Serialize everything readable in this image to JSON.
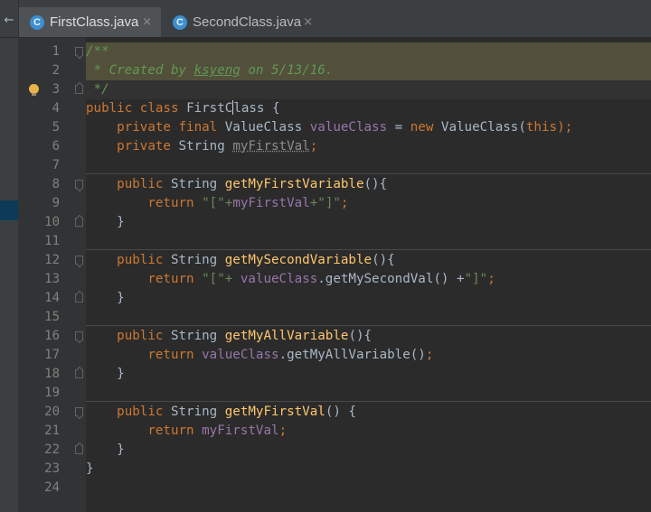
{
  "tabs": [
    {
      "icon": "C",
      "label": "FirstClass.java",
      "close": "×",
      "active": true
    },
    {
      "icon": "C",
      "label": "SecondClass.java",
      "close": "×",
      "active": false
    }
  ],
  "nav": {
    "back_arrow": "←"
  },
  "gutter": {
    "line_numbers": [
      "1",
      "2",
      "3",
      "4",
      "5",
      "6",
      "7",
      "8",
      "9",
      "10",
      "11",
      "12",
      "13",
      "14",
      "15",
      "16",
      "17",
      "18",
      "19",
      "20",
      "21",
      "22",
      "23",
      "24"
    ]
  },
  "editor": {
    "file": "FirstClass.java",
    "comment": {
      "open": "/**",
      "prefix": " * Created by ",
      "author": "ksyeng",
      "suffix": " on 5/13/16.",
      "close": " */"
    },
    "class_decl": {
      "kw1": "public",
      "kw2": "class",
      "name_before_caret": "FirstC",
      "name_after_caret": "lass",
      "brace": " {"
    },
    "field1": {
      "mods": "private final",
      "type": " ValueClass ",
      "name": "valueClass",
      "eq": " = ",
      "new": "new",
      "call": " ValueClass(",
      "this": "this",
      "end": ");"
    },
    "field2": {
      "mods": "private",
      "type": " String ",
      "name": "myFirstVal",
      "end": ";"
    },
    "methods": [
      {
        "sig_kw": "public",
        "type": " String ",
        "name": "getMyFirstVariable",
        "params": "(){",
        "ret": "return",
        "body_a": " \"[\"+",
        "body_b": "myFirstVal",
        "body_c": "+\"]\"",
        "body_d": ";",
        "close": "}"
      },
      {
        "sig_kw": "public",
        "type": " String ",
        "name": "getMySecondVariable",
        "params": "(){",
        "ret": "return",
        "body_a": " \"[\"+ ",
        "body_b": "valueClass",
        "body_c": ".getMySecondVal() +",
        "body_d": "\"]\"",
        "body_e": ";",
        "close": "}"
      },
      {
        "sig_kw": "public",
        "type": " String ",
        "name": "getMyAllVariable",
        "params": "(){",
        "ret": "return",
        "body_a": " ",
        "body_b": "valueClass",
        "body_c": ".getMyAllVariable()",
        "body_d": ";",
        "close": "}"
      },
      {
        "sig_kw": "public",
        "type": " String ",
        "name": "getMyFirstVal",
        "params": "() {",
        "ret": "return",
        "body_a": " ",
        "body_b": "myFirstVal",
        "body_d": ";",
        "close": "}"
      }
    ],
    "class_close": "}"
  },
  "colors": {
    "background": "#2b2b2b",
    "keyword": "#cc7832",
    "comment": "#629755",
    "method": "#ffc66d",
    "string": "#6a8759",
    "field": "#9876aa",
    "text": "#a9b7c6"
  }
}
